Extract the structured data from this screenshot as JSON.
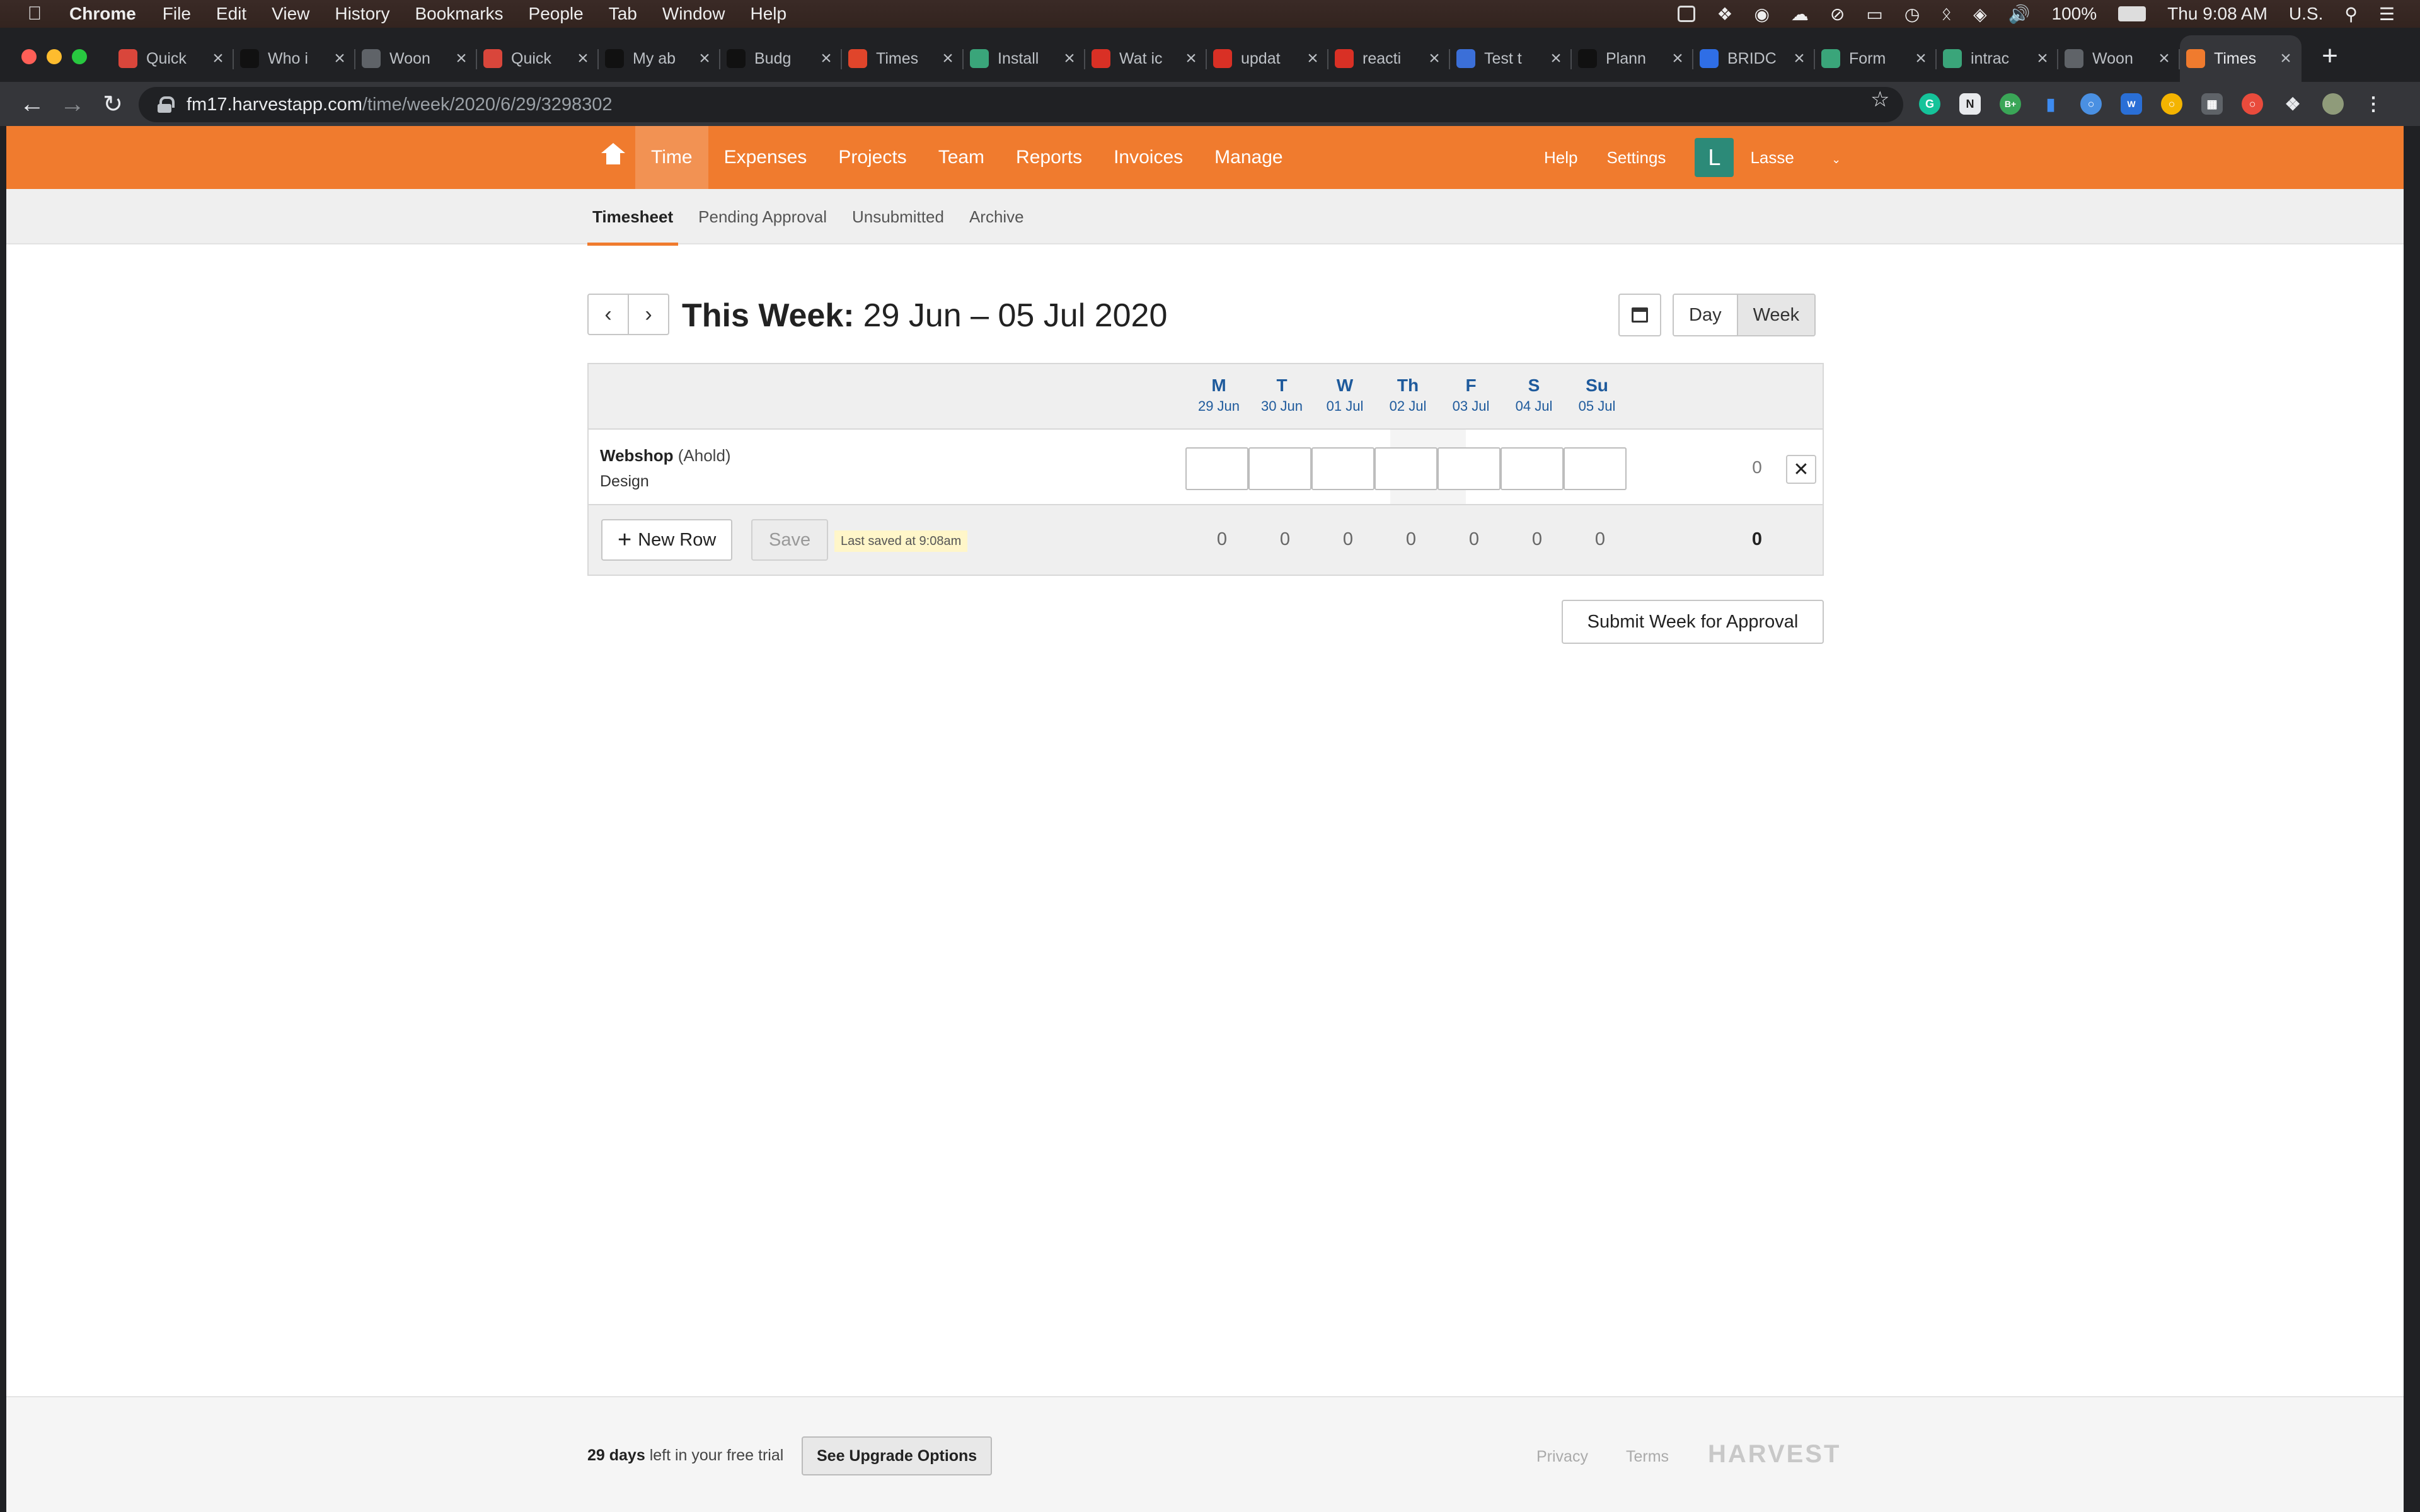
{
  "menubar": {
    "app_name": "Chrome",
    "menus": [
      "File",
      "Edit",
      "View",
      "History",
      "Bookmarks",
      "People",
      "Tab",
      "Window",
      "Help"
    ],
    "battery": "100%",
    "clock": "Thu 9:08 AM",
    "input_source": "U.S."
  },
  "tabs": [
    {
      "title": "Quick",
      "color": "#d9463b"
    },
    {
      "title": "Who i",
      "color": "#111111"
    },
    {
      "title": "Woon",
      "color": "#5f6368"
    },
    {
      "title": "Quick",
      "color": "#d9463b"
    },
    {
      "title": "My ab",
      "color": "#111111"
    },
    {
      "title": "Budg",
      "color": "#111111"
    },
    {
      "title": "Times",
      "color": "#e0452b"
    },
    {
      "title": "Install",
      "color": "#3aa57a"
    },
    {
      "title": "Wat ic",
      "color": "#d93025"
    },
    {
      "title": "updat",
      "color": "#d93025"
    },
    {
      "title": "reacti",
      "color": "#d93025"
    },
    {
      "title": "Test t",
      "color": "#3b6fd8"
    },
    {
      "title": "Plann",
      "color": "#111111"
    },
    {
      "title": "BRIDC",
      "color": "#2f6ee6"
    },
    {
      "title": "Form",
      "color": "#3aa57a"
    },
    {
      "title": "intrac",
      "color": "#3aa57a"
    },
    {
      "title": "Woon",
      "color": "#5f6368"
    },
    {
      "title": "Times",
      "color": "#f07b2e",
      "active": true
    }
  ],
  "omnibox": {
    "host": "fm17.harvestapp.com",
    "path": "/time/week/2020/6/29/3298302"
  },
  "header": {
    "nav": [
      "Time",
      "Expenses",
      "Projects",
      "Team",
      "Reports",
      "Invoices",
      "Manage"
    ],
    "help": "Help",
    "settings": "Settings",
    "avatar_initial": "L",
    "user": "Lasse",
    "accent": "#f07b2e"
  },
  "subnav": [
    "Timesheet",
    "Pending Approval",
    "Unsubmitted",
    "Archive"
  ],
  "week": {
    "prefix": "This Week:",
    "range": "29 Jun – 05 Jul 2020",
    "view_day": "Day",
    "view_week": "Week"
  },
  "days": [
    {
      "name": "M",
      "date": "29 Jun"
    },
    {
      "name": "T",
      "date": "30 Jun"
    },
    {
      "name": "W",
      "date": "01 Jul"
    },
    {
      "name": "Th",
      "date": "02 Jul"
    },
    {
      "name": "F",
      "date": "03 Jul"
    },
    {
      "name": "S",
      "date": "04 Jul"
    },
    {
      "name": "Su",
      "date": "05 Jul"
    }
  ],
  "row": {
    "project": "Webshop",
    "client": "(Ahold)",
    "task": "Design",
    "total": "0",
    "delete_glyph": "✕"
  },
  "footer_row": {
    "new_row": "New Row",
    "save": "Save",
    "last_saved": "Last saved at 9:08am",
    "totals": [
      "0",
      "0",
      "0",
      "0",
      "0",
      "0",
      "0"
    ],
    "grand_total": "0"
  },
  "submit": "Submit Week for Approval",
  "page_footer": {
    "trial_days": "29 days",
    "trial_text": " left in your free trial",
    "upgrade": "See Upgrade Options",
    "privacy": "Privacy",
    "terms": "Terms",
    "logo": "HARVEST"
  }
}
